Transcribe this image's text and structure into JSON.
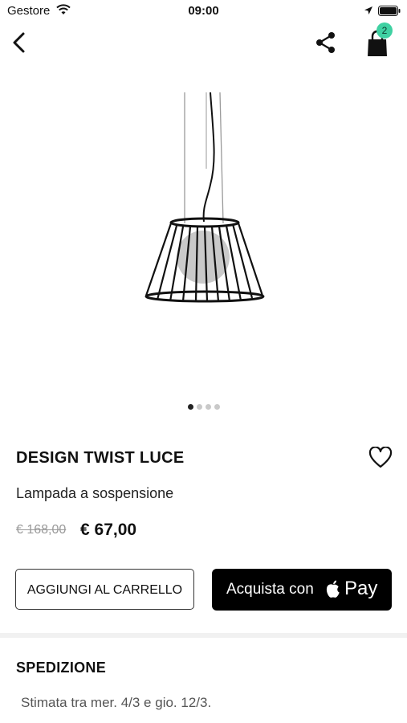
{
  "status_bar": {
    "carrier": "Gestore",
    "time": "09:00"
  },
  "nav": {
    "cart_count": "2"
  },
  "gallery": {
    "image_count": 4,
    "active_index": 0
  },
  "product": {
    "title": "DESIGN TWIST LUCE",
    "subtitle": "Lampada a sospensione",
    "price_old": "€ 168,00",
    "price_new": "€ 67,00"
  },
  "actions": {
    "add_to_cart": "AGGIUNGI AL CARRELLO",
    "buy_with": "Acquista con",
    "pay_word": "Pay"
  },
  "shipping": {
    "title": "SPEDIZIONE",
    "estimate": "Stimata tra mer. 4/3 e gio. 12/3."
  },
  "colors": {
    "badge": "#3fd1a2",
    "pay_button": "#000000"
  }
}
